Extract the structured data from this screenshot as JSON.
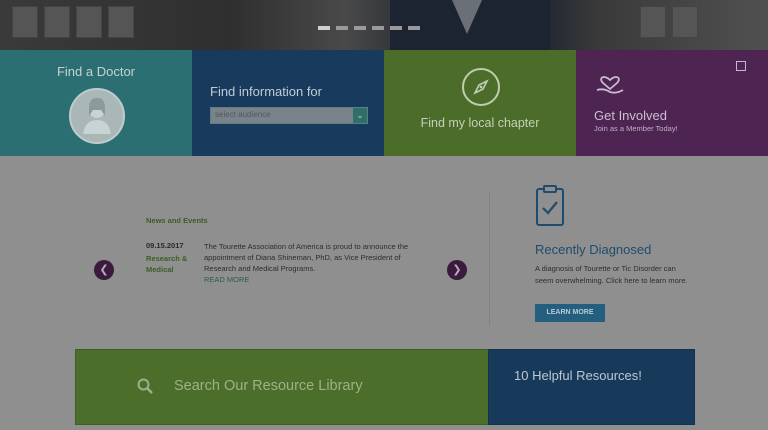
{
  "hero": {
    "slide_count": 6,
    "active_slide": 1
  },
  "tiles": {
    "find_doctor": {
      "label": "Find a Doctor",
      "icon": "doctor-icon"
    },
    "find_info": {
      "label": "Find information for",
      "select_placeholder": "select audience",
      "icon": "chevron-down-icon"
    },
    "chapter": {
      "label": "Find my local chapter",
      "icon": "compass-icon"
    },
    "get_involved": {
      "label": "Get Involved",
      "sub": "Join as a Member Today!",
      "icon": "heart-hand-icon"
    }
  },
  "news": {
    "section_title": "News and Events",
    "date": "09.15.2017",
    "category": "Research & Medical",
    "body": "The Tourette Association of America is proud to announce the appointment of Diana Shineman, PhD, as Vice President of Research and Medical Programs.",
    "read_more": "READ MORE"
  },
  "recently": {
    "title": "Recently Diagnosed",
    "body": "A diagnosis of Tourette or Tic Disorder can seem overwhelming. Click here to learn more.",
    "button": "LEARN MORE",
    "icon": "clipboard-check-icon"
  },
  "search": {
    "placeholder": "Search Our Resource Library",
    "icon": "search-icon"
  },
  "resources": {
    "label": "10 Helpful Resources!"
  },
  "colors": {
    "teal": "#2b6f72",
    "navy": "#183a5d",
    "green": "#4c6d2a",
    "purple": "#4e2452"
  }
}
